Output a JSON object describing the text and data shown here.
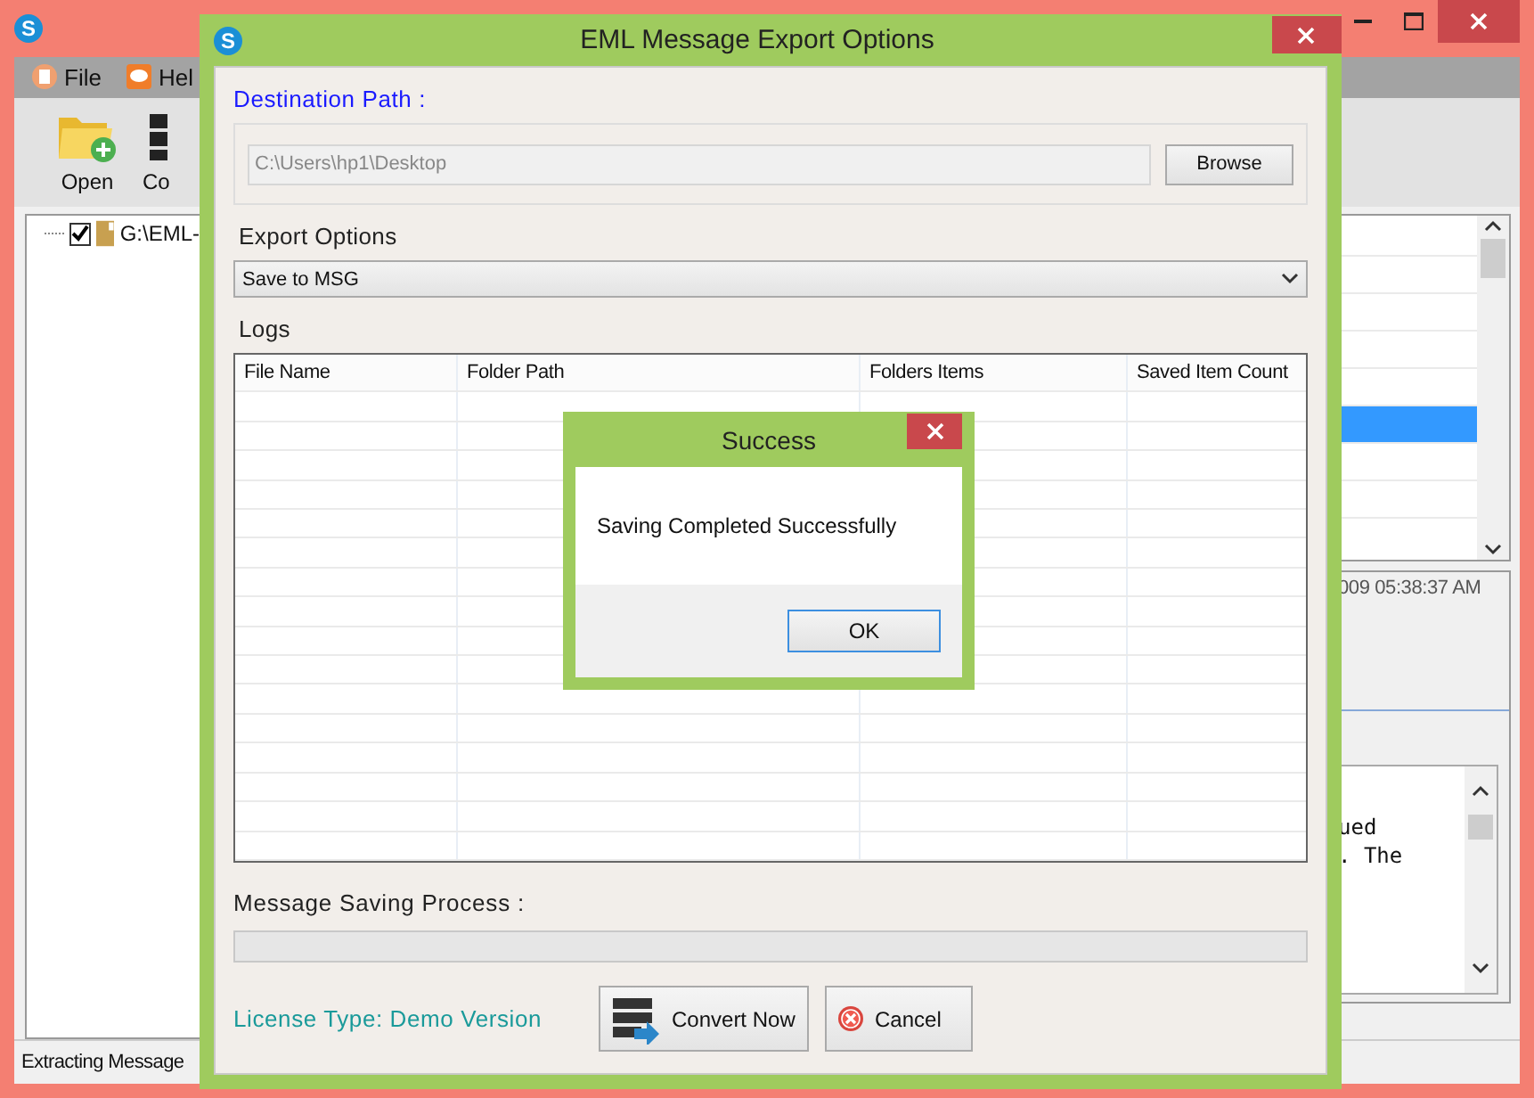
{
  "main_window": {
    "icon_letter": "S",
    "menu": [
      "File",
      "Hel"
    ],
    "toolbar": [
      "Open",
      "Co"
    ],
    "tree": [
      {
        "label": "G:\\EML-",
        "checked": true
      }
    ],
    "list_rows": [
      {
        "selected": false
      },
      {
        "selected": false
      },
      {
        "selected": false
      },
      {
        "selected": false
      },
      {
        "selected": false
      },
      {
        "selected": true
      },
      {
        "selected": false
      },
      {
        "selected": false
      }
    ],
    "detail_date": "009 05:38:37 AM",
    "preview_lines": [
      "ued",
      ". The"
    ],
    "status_bar": "Extracting Message"
  },
  "dialog": {
    "icon_letter": "S",
    "title": "EML Message Export Options",
    "destination_label": "Destination Path :",
    "destination_value": "C:\\Users\\hp1\\Desktop",
    "browse": "Browse",
    "export_label": "Export Options",
    "export_value": "Save to MSG",
    "logs_label": "Logs",
    "log_columns": [
      "File Name",
      "Folder Path",
      "Folders Items",
      "Saved Item Count"
    ],
    "progress_label": "Message Saving Process :",
    "progress": {
      "level": 0
    },
    "license": "License Type: Demo Version",
    "buttons": [
      {
        "kind": "convert",
        "label": "Convert Now"
      },
      {
        "kind": "cancel",
        "label": "Cancel"
      }
    ]
  },
  "popup": {
    "title": "Success",
    "message": "Saving Completed Successfully",
    "ok": "OK"
  }
}
